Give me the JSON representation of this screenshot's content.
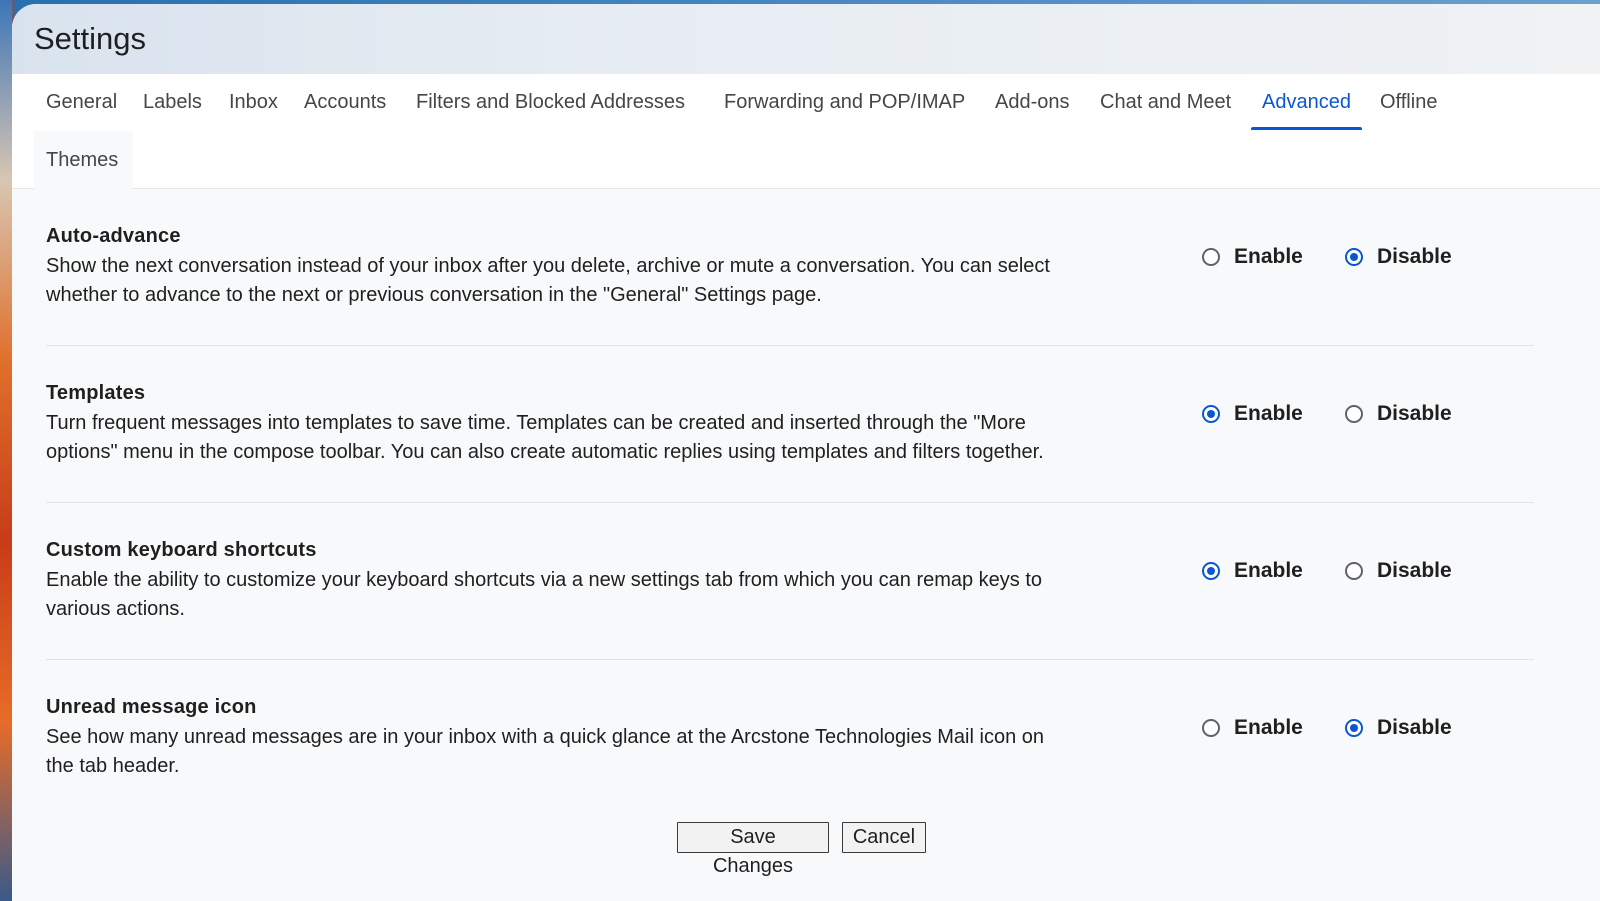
{
  "page_title": "Settings",
  "tabs": [
    {
      "label": "General"
    },
    {
      "label": "Labels"
    },
    {
      "label": "Inbox"
    },
    {
      "label": "Accounts"
    },
    {
      "label": "Filters and Blocked Addresses"
    },
    {
      "label": "Forwarding and POP/IMAP"
    },
    {
      "label": "Add-ons"
    },
    {
      "label": "Chat and Meet"
    },
    {
      "label": "Advanced",
      "active": true
    },
    {
      "label": "Offline"
    },
    {
      "label": "Themes"
    }
  ],
  "settings": [
    {
      "heading": "Auto-advance",
      "desc_line1": "Show the next conversation instead of your inbox after you delete, archive or mute a conversation. You can select",
      "desc_line2": "whether to advance to the next or previous conversation in the \"General\" Settings page.",
      "enable_label": "Enable",
      "disable_label": "Disable",
      "selected": "Disable"
    },
    {
      "heading": "Templates",
      "desc_line1": "Turn frequent messages into templates to save time. Templates can be created and inserted through the \"More",
      "desc_line2": "options\" menu in the compose toolbar. You can also create automatic replies using templates and filters together.",
      "enable_label": "Enable",
      "disable_label": "Disable",
      "selected": "Enable"
    },
    {
      "heading": "Custom keyboard shortcuts",
      "desc_line1": "Enable the ability to customize your keyboard shortcuts via a new settings tab from which you can remap keys to",
      "desc_line2": "various actions.",
      "enable_label": "Enable",
      "disable_label": "Disable",
      "selected": "Enable"
    },
    {
      "heading": "Unread message icon",
      "desc_line1": "See how many unread messages are in your inbox with a quick glance at the Arcstone Technologies Mail icon on",
      "desc_line2": "the tab header.",
      "enable_label": "Enable",
      "disable_label": "Disable",
      "selected": "Disable"
    }
  ],
  "buttons": {
    "save_label": "Save Changes",
    "cancel_label": "Cancel"
  },
  "colors": {
    "accent": "#0b57d0",
    "text": "#1f1f1f",
    "tab_text": "#444746"
  }
}
